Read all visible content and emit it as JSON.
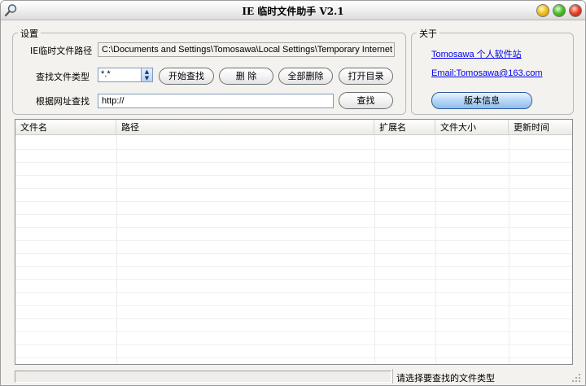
{
  "window": {
    "title": "IE 临时文件助手 V2.1"
  },
  "settings": {
    "legend": "设置",
    "path_label": "IE临时文件路径",
    "path_value": "C:\\Documents and Settings\\Tomosawa\\Local Settings\\Temporary Internet Files",
    "type_label": "查找文件类型",
    "type_value": "*.*",
    "start_button": "开始查找",
    "delete_button": "删 除",
    "delete_all_button": "全部删除",
    "open_dir_button": "打开目录",
    "url_label": "根据网址查找",
    "url_value": "http://",
    "find_button": "查找"
  },
  "about": {
    "legend": "关于",
    "site_link_latin": "Tomosawa",
    "site_link_cjk": "个人软件站",
    "email_link": "Email:Tomosawa@163.com",
    "version_button": "版本信息"
  },
  "list": {
    "columns": [
      "文件名",
      "路径",
      "扩展名",
      "文件大小",
      "更新时间"
    ]
  },
  "status": {
    "text": "请选择要查找的文件类型",
    "progress": 0
  },
  "icons": {
    "app": "magnifier-icon",
    "min": "minimize-icon",
    "max": "maximize-icon",
    "close": "close-icon",
    "grip": "resize-grip-icon"
  }
}
